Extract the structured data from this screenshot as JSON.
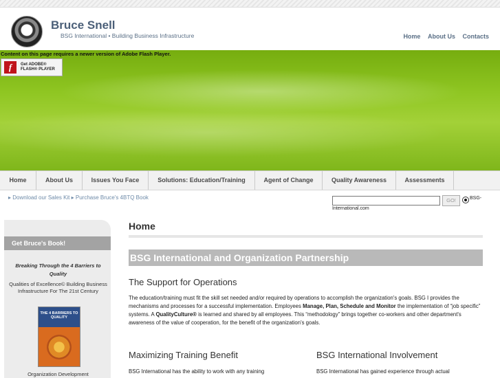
{
  "header": {
    "title": "Bruce Snell",
    "subtitle": "BSG International • Building Business Infrastructure",
    "top_nav": [
      "Home",
      "About Us",
      "Contacts"
    ]
  },
  "flash": {
    "message": "Content on this page requires a newer version of Adobe Flash Player.",
    "badge_line1": "Get ADOBE®",
    "badge_line2": "FLASH® PLAYER"
  },
  "main_nav": [
    "Home",
    "About Us",
    "Issues You Face",
    "Solutions: Education/Training",
    "Agent of Change",
    "Quality Awareness",
    "Assessments"
  ],
  "sub_nav": {
    "link1": "Download our Sales Kit",
    "link2": "Purchase Bruce's 4BTQ Book"
  },
  "search": {
    "value": "",
    "button": "GO!",
    "radio_label_part1": "BSG-",
    "radio_label_part2": "International.com"
  },
  "sidebar": {
    "heading": "Get Bruce's Book!",
    "book_title": "Breaking Through the 4 Barriers to Quality",
    "book_subtitle": "Qualities of Excellence© Building Business Infrastructure For The 21st Century",
    "cover_text": "THE 4 BARRIERS TO QUALITY",
    "more_text": "Organization Development"
  },
  "main": {
    "page_title": "Home",
    "section_title": "BSG International and Organization Partnership",
    "subheading": "The Support for Operations",
    "paragraph": {
      "p1": "The education/training must fit the skill set needed and/or required by operations to accomplish the organization's goals. BSG I provides the mechanisms and processes for a successful implementation. Employees ",
      "b1": "Manage, Plan, Schedule and Monitor",
      "p2": " the implementation of “job specific” systems. A ",
      "b2": "QualityCulture®",
      "p3": " is learned and shared by all employees. This “methodology” brings together co-workers and other department's awareness of the value of cooperation, for the benefit of the organization's goals."
    },
    "col1": {
      "heading": "Maximizing Training Benefit",
      "text": "BSG International has the ability to work with any training"
    },
    "col2": {
      "heading": "BSG International Involvement",
      "text": "BSG International has gained experience through actual"
    }
  }
}
